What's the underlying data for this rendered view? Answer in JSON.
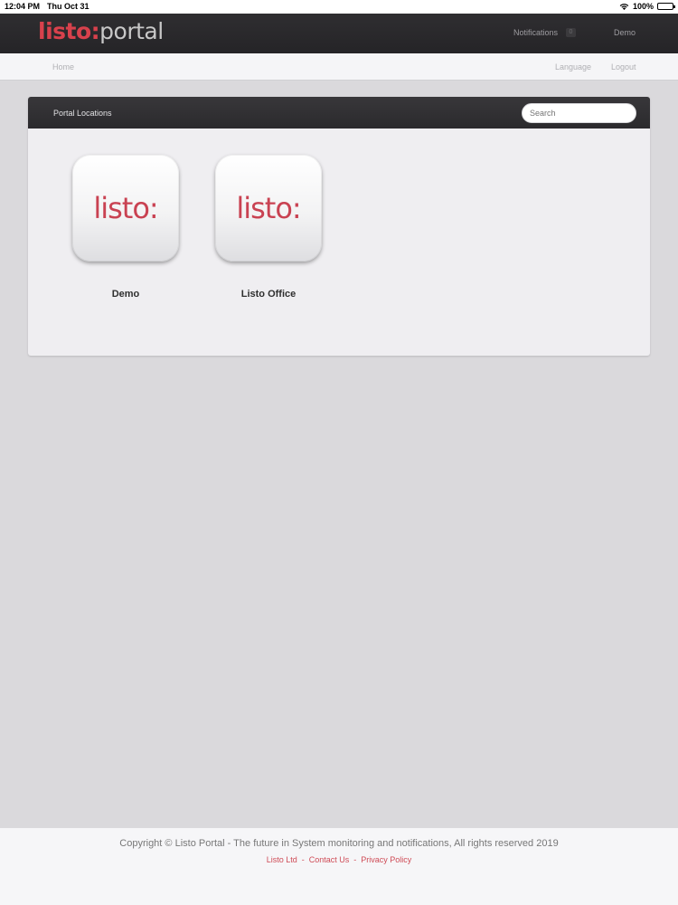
{
  "status_bar": {
    "time": "12:04 PM",
    "date": "Thu Oct 31",
    "battery": "100%",
    "battery_level": 1.0
  },
  "header": {
    "logo_part1": "listo:",
    "logo_part2": "portal",
    "notifications_label": "Notifications",
    "notifications_count": "0",
    "user_label": "Demo"
  },
  "subnav": {
    "home": "Home",
    "language": "Language",
    "logout": "Logout"
  },
  "panel": {
    "title": "Portal Locations",
    "search_placeholder": "Search",
    "locations": [
      {
        "logo": "listo:",
        "label": "Demo"
      },
      {
        "logo": "listo:",
        "label": "Listo Office"
      }
    ]
  },
  "footer": {
    "copyright": "Copyright © Listo Portal - The future in System monitoring and notifications, All rights reserved 2019",
    "links": [
      "Listo Ltd",
      "Contact Us",
      "Privacy Policy"
    ],
    "separator": "-"
  },
  "colors": {
    "brand_red": "#d8414c",
    "header_bg": "#2f2e31",
    "page_bg": "#dad9dc"
  }
}
